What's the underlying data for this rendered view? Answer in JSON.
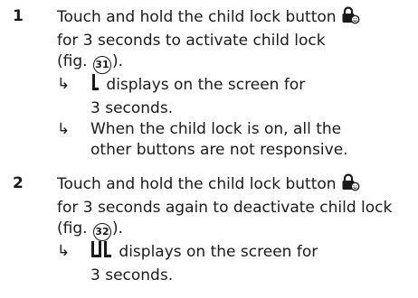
{
  "steps": [
    {
      "number": "1",
      "line1_text": "Touch and hold the child lock button",
      "line2": "for 3 seconds to activate child lock",
      "fig_prefix": "(fig.",
      "fig_num": "31",
      "fig_suffix": ").",
      "results": [
        {
          "arrow": "↳",
          "line1_text": "displays on the screen for",
          "line2": "3 seconds.",
          "display_icon": "display-bracket-icon"
        },
        {
          "arrow": "↳",
          "line1": "When the child lock is on, all the",
          "line2": "other buttons are not responsive."
        }
      ]
    },
    {
      "number": "2",
      "line1_text": "Touch and hold the child lock button",
      "line2": "for 3 seconds again to deactivate child lock",
      "fig_prefix": "(fig.",
      "fig_num": "32",
      "fig_suffix": ").",
      "results": [
        {
          "arrow": "↳",
          "line1_text": "displays on the screen for",
          "line2": "3 seconds.",
          "display_icon": "display-ul-icon"
        }
      ]
    }
  ],
  "icons": {
    "child_lock": "child-lock-icon"
  }
}
